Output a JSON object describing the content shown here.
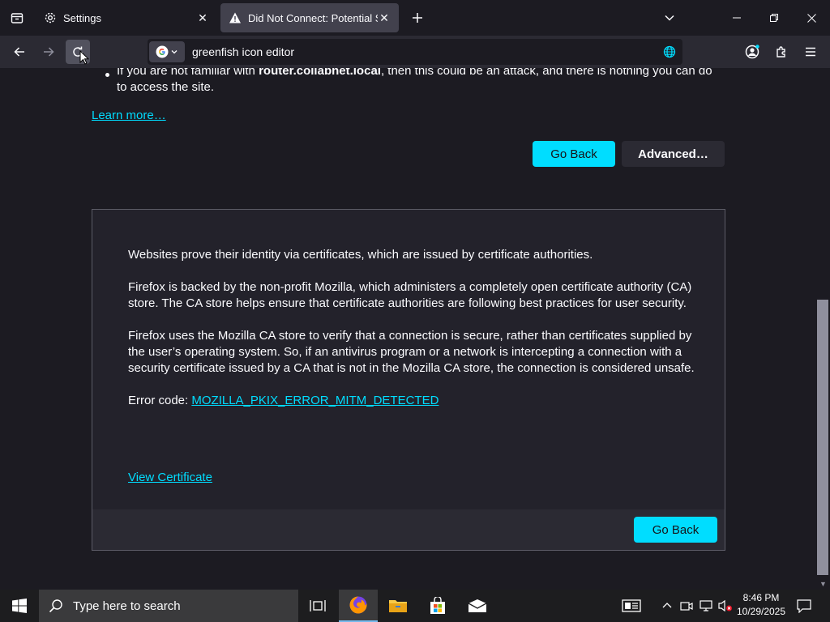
{
  "tabs": [
    {
      "title": "Settings",
      "icon": "gear-icon"
    },
    {
      "title": "Did Not Connect: Potential Security Issue",
      "icon": "warning-icon"
    }
  ],
  "navbar": {
    "url": "greenfish icon editor",
    "search_engine": "google-icon"
  },
  "content": {
    "bullet_prefix": "If you are not familiar with ",
    "bullet_host": "router.collabnet.local",
    "bullet_suffix": ", then this could be an attack, and there is nothing you can do to access the site.",
    "learn_more": "Learn more…",
    "go_back": "Go Back",
    "advanced": "Advanced…",
    "advanced_panel": {
      "p1": "Websites prove their identity via certificates, which are issued by certificate authorities.",
      "p2": "Firefox is backed by the non-profit Mozilla, which administers a completely open certificate authority (CA) store. The CA store helps ensure that certificate authorities are following best practices for user security.",
      "p3": "Firefox uses the Mozilla CA store to verify that a connection is secure, rather than certificates supplied by the user’s operating system. So, if an antivirus program or a network is intercepting a connection with a security certificate issued by a CA that is not in the Mozilla CA store, the connection is considered unsafe.",
      "error_code_label": "Error code: ",
      "error_code": "MOZILLA_PKIX_ERROR_MITM_DETECTED",
      "view_certificate": "View Certificate",
      "go_back": "Go Back"
    }
  },
  "taskbar": {
    "search_placeholder": "Type here to search",
    "time": "8:46 PM",
    "date": "10/29/2025"
  },
  "colors": {
    "accent": "#00ddff",
    "background": "#1c1b22",
    "toolbar": "#2b2a33"
  }
}
